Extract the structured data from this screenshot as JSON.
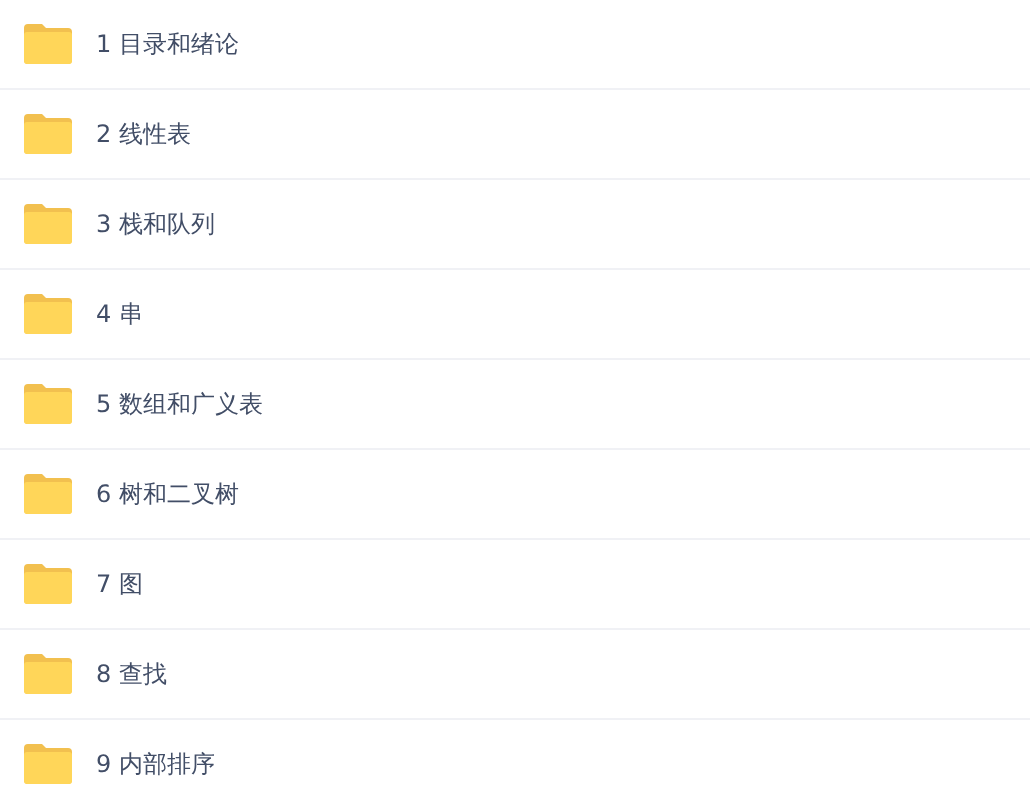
{
  "files": [
    {
      "name": "1 目录和绪论"
    },
    {
      "name": "2 线性表"
    },
    {
      "name": "3 栈和队列"
    },
    {
      "name": "4 串"
    },
    {
      "name": "5 数组和广义表"
    },
    {
      "name": "6 树和二叉树"
    },
    {
      "name": "7 图"
    },
    {
      "name": "8 查找"
    },
    {
      "name": "9 内部排序"
    }
  ]
}
